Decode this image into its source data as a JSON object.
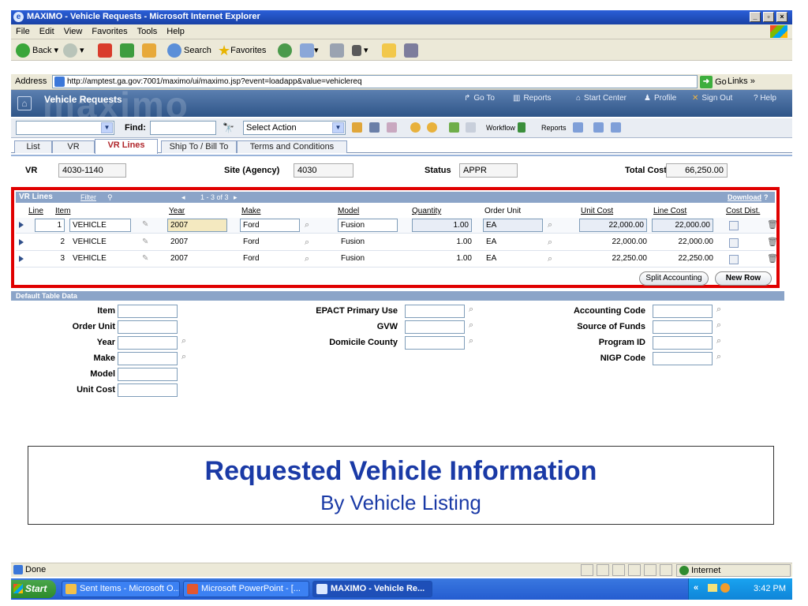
{
  "window": {
    "title": "MAXIMO - Vehicle Requests - Microsoft Internet Explorer"
  },
  "menu": [
    "File",
    "Edit",
    "View",
    "Favorites",
    "Tools",
    "Help"
  ],
  "toolbar": {
    "back": "Back",
    "search": "Search",
    "favorites": "Favorites"
  },
  "address": {
    "label": "Address",
    "url": "http://amptest.ga.gov:7001/maximo/ui/maximo.jsp?event=loadapp&value=vehiclereq",
    "go": "Go",
    "links": "Links"
  },
  "app": {
    "watermark": "maximo",
    "name": "Vehicle Requests",
    "nav": {
      "goto": "Go To",
      "reports": "Reports",
      "start_center": "Start Center",
      "profile": "Profile",
      "sign_out": "Sign Out",
      "help": "? Help"
    }
  },
  "actions": {
    "find_label": "Find:",
    "select_action": "Select Action",
    "workflow": "Workflow",
    "reports": "Reports"
  },
  "tabs": [
    "List",
    "VR",
    "VR Lines",
    "Ship To / Bill To",
    "Terms and Conditions"
  ],
  "header_fields": {
    "vr_label": "VR",
    "vr_value": "4030-1140",
    "site_label": "Site (Agency)",
    "site_value": "4030",
    "status_label": "Status",
    "status_value": "APPR",
    "total_label": "Total Cost",
    "total_value": "66,250.00"
  },
  "vr_lines": {
    "title": "VR Lines",
    "filter": "Filter",
    "count": "1 - 3 of 3",
    "download": "Download",
    "columns": [
      "Line",
      "Item",
      "Year",
      "Make",
      "Model",
      "Quantity",
      "Order Unit",
      "Unit Cost",
      "Line Cost",
      "Cost Dist."
    ],
    "rows": [
      {
        "line": "1",
        "item": "VEHICLE",
        "year": "2007",
        "make": "Ford",
        "model": "Fusion",
        "quantity": "1.00",
        "unit": "EA",
        "unit_cost": "22,000.00",
        "line_cost": "22,000.00"
      },
      {
        "line": "2",
        "item": "VEHICLE",
        "year": "2007",
        "make": "Ford",
        "model": "Fusion",
        "quantity": "1.00",
        "unit": "EA",
        "unit_cost": "22,000.00",
        "line_cost": "22,000.00"
      },
      {
        "line": "3",
        "item": "VEHICLE",
        "year": "2007",
        "make": "Ford",
        "model": "Fusion",
        "quantity": "1.00",
        "unit": "EA",
        "unit_cost": "22,250.00",
        "line_cost": "22,250.00"
      }
    ],
    "split_button": "Split Accounting",
    "new_row_button": "New Row"
  },
  "default_table": {
    "title": "Default Table Data",
    "col1": [
      "Item",
      "Order Unit",
      "Year",
      "Make",
      "Model",
      "Unit Cost"
    ],
    "col2": [
      "EPACT Primary Use",
      "GVW",
      "Domicile County"
    ],
    "col3": [
      "Accounting Code",
      "Source of Funds",
      "Program ID",
      "NIGP Code"
    ]
  },
  "caption": {
    "title": "Requested Vehicle Information",
    "subtitle": "By Vehicle Listing"
  },
  "status": {
    "text": "Done",
    "zone": "Internet"
  },
  "taskbar": {
    "start": "Start",
    "tasks": [
      "Sent Items - Microsoft O...",
      "Microsoft PowerPoint - [...",
      "MAXIMO - Vehicle Re..."
    ],
    "clock": "3:42 PM"
  }
}
